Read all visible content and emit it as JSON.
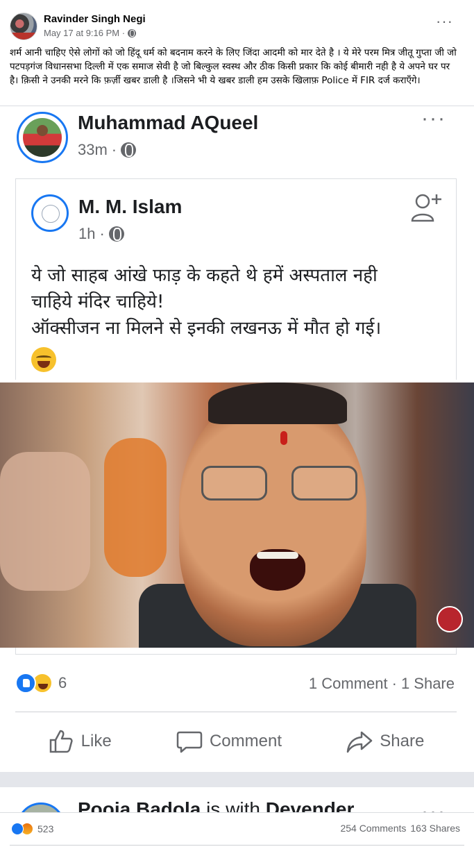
{
  "outer_post": {
    "author": "Ravinder Singh Negi",
    "timestamp": "May 17 at 9:16 PM ·",
    "privacy_icon": "globe-icon",
    "more_icon": "···",
    "text": "शर्म आनी चाहिए ऐसे लोगों को जो हिंदू धर्म को बदनाम करने के लिए जिंदा आदमी को मार देते है । ये मेरे परम मित्र जीतू गुप्ता जी जो पटपड़गंज विधानसभा दिल्ली  में एक समाज सेवी है जो बिल्कुल स्वस्थ और ठीक किसी प्रकार कि कोई बीमारी नही है ये अपने घर पर  है। क़िसी ने उनकी मरने कि फ़र्ज़ी खबर डाली है ।जिसने भी ये खबर डाली हम उसके खिलाफ़ Police में FIR दर्ज कराएँगे।"
  },
  "shared_post": {
    "author": "Muhammad AQueel",
    "time": "33m",
    "separator": "·",
    "more_icon": "···",
    "quoted": {
      "author": "M. M. Islam",
      "time": "1h",
      "separator": "·",
      "line1": "ये जो साहब आंखे फाड़ के कहते थे हमें अस्पताल नही",
      "line2": "चाहिये मंदिर चाहिये!",
      "line3": "ऑक्सीजन ना मिलने से इनकी लखनऊ में मौत हो गई।",
      "emoji": "laughing-tears-emoji"
    },
    "reaction_count": "6",
    "comments": "1 Comment",
    "dot": "·",
    "shares": "1 Share",
    "actions": {
      "like": "Like",
      "comment": "Comment",
      "share": "Share"
    }
  },
  "next_post": {
    "name_partial": "Pooja Badola",
    "with_text": " is with ",
    "with_name": "Devender",
    "more_icon": "···"
  },
  "outer_footer": {
    "reaction_count": "523",
    "comments": "254 Comments",
    "shares": "163 Shares"
  },
  "colors": {
    "accent": "#1877f2",
    "secondary_text": "#65676b",
    "divider": "#ced0d4"
  }
}
